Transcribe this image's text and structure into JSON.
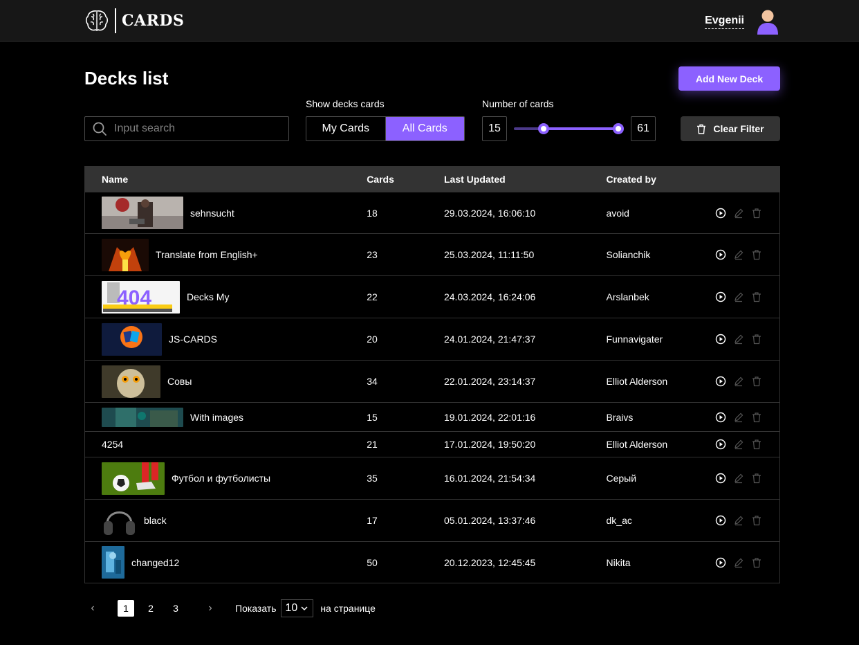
{
  "header": {
    "logo_text": "CARDS",
    "user_name": "Evgenii"
  },
  "page": {
    "title": "Decks list",
    "add_button": "Add New Deck"
  },
  "filters": {
    "search_placeholder": "Input search",
    "show_label": "Show decks cards",
    "tabs": [
      {
        "label": "My Cards",
        "active": false
      },
      {
        "label": "All Cards",
        "active": true
      }
    ],
    "number_label": "Number of cards",
    "min": "15",
    "max": "61",
    "clear_button": "Clear Filter"
  },
  "table": {
    "headers": {
      "name": "Name",
      "cards": "Cards",
      "updated": "Last Updated",
      "created": "Created by"
    },
    "rows": [
      {
        "name": "sehnsucht",
        "cards": "18",
        "updated": "29.03.2024, 16:06:10",
        "created": "avoid"
      },
      {
        "name": "Translate from English+",
        "cards": "23",
        "updated": "25.03.2024, 11:11:50",
        "created": "Solianchik"
      },
      {
        "name": "Decks My",
        "cards": "22",
        "updated": "24.03.2024, 16:24:06",
        "created": "Arslanbek"
      },
      {
        "name": "JS-CARDS",
        "cards": "20",
        "updated": "24.01.2024, 21:47:37",
        "created": "Funnavigater"
      },
      {
        "name": "Совы",
        "cards": "34",
        "updated": "22.01.2024, 23:14:37",
        "created": "Elliot Alderson"
      },
      {
        "name": "With images",
        "cards": "15",
        "updated": "19.01.2024, 22:01:16",
        "created": "Braivs"
      },
      {
        "name": "4254",
        "cards": "21",
        "updated": "17.01.2024, 19:50:20",
        "created": "Elliot Alderson"
      },
      {
        "name": "Футбол и футболисты",
        "cards": "35",
        "updated": "16.01.2024, 21:54:34",
        "created": "Серый"
      },
      {
        "name": "black",
        "cards": "17",
        "updated": "05.01.2024, 13:37:46",
        "created": "dk_ac"
      },
      {
        "name": "changed12",
        "cards": "50",
        "updated": "20.12.2023, 12:45:45",
        "created": "Nikita"
      }
    ]
  },
  "pagination": {
    "pages": [
      "1",
      "2",
      "3"
    ],
    "current": "1",
    "show_label": "Показать",
    "per_page": "10",
    "per_page_suffix": "на странице"
  },
  "colors": {
    "accent": "#8c61ff",
    "header_bg": "#171717",
    "table_head_bg": "#333333"
  }
}
